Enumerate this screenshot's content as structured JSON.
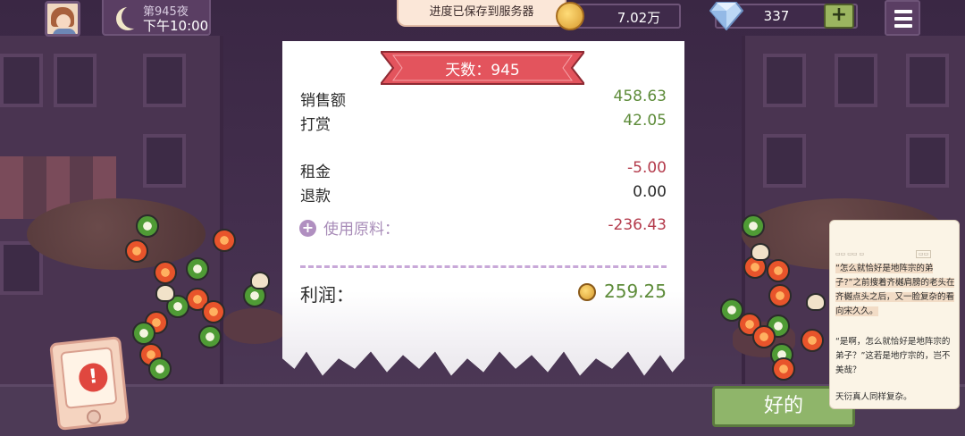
{
  "hud": {
    "day_label": "第945夜",
    "time": "下午10:00",
    "toast": "进度已保存到服务器",
    "coins": "7.02万",
    "gems": "337",
    "plus_label": "+"
  },
  "receipt": {
    "day_title": "天数：945",
    "sales_label": "销售额",
    "sales_value": "458.63",
    "tips_label": "打赏",
    "tips_value": "42.05",
    "rent_label": "租金",
    "rent_value": "-5.00",
    "refund_label": "退款",
    "refund_value": "0.00",
    "ingredients_label": "使用原料：",
    "ingredients_value": "-236.43",
    "profit_label": "利润：",
    "profit_value": "259.25"
  },
  "ok_button": "好的",
  "reader": {
    "p1": "“怎么就恰好是地阵宗的弟子?”之前搜着齐樾肩膀的老头在齐樾点头之后，又一脸复杂的看向宋久久。",
    "p2": "“是啊，怎么就恰好是地阵宗的弟子？”这若是地疗宗的，岂不美哉？",
    "p3": "天衍真人同样复杂。"
  },
  "colors": {
    "positive": "#5e8c3a",
    "negative": "#b43b4c",
    "banner": "#e3545d",
    "ok_button": "#8fb56a"
  }
}
